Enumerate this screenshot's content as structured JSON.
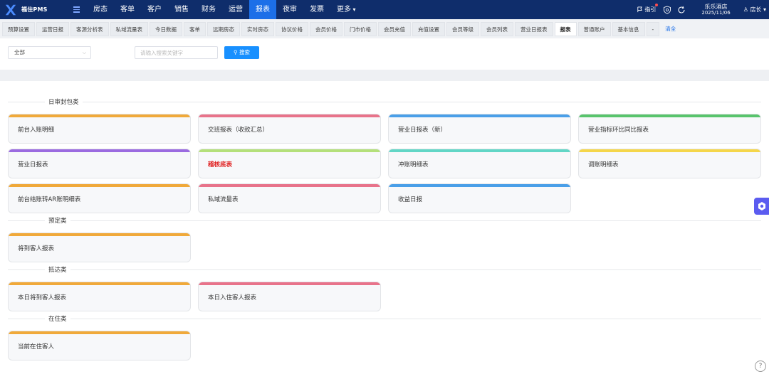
{
  "brand": {
    "name": "福住PMS"
  },
  "nav": {
    "items": [
      {
        "label": "房态",
        "active": false
      },
      {
        "label": "客单",
        "active": false
      },
      {
        "label": "客户",
        "active": false
      },
      {
        "label": "销售",
        "active": false
      },
      {
        "label": "财务",
        "active": false
      },
      {
        "label": "运营",
        "active": false
      },
      {
        "label": "报表",
        "active": true
      },
      {
        "label": "夜审",
        "active": false
      },
      {
        "label": "发票",
        "active": false
      },
      {
        "label": "更多",
        "active": false
      }
    ],
    "guide_label": "指引",
    "hotel_name": "乐乐酒店",
    "date": "2025/11/06",
    "user_label": "店长"
  },
  "tabs": [
    {
      "label": "预算设置",
      "active": false
    },
    {
      "label": "运营日报",
      "active": false
    },
    {
      "label": "客源分析表",
      "active": false
    },
    {
      "label": "私域流量表",
      "active": false
    },
    {
      "label": "今日数据",
      "active": false
    },
    {
      "label": "客单",
      "active": false
    },
    {
      "label": "远期房态",
      "active": false
    },
    {
      "label": "实时房态",
      "active": false
    },
    {
      "label": "协议价格",
      "active": false
    },
    {
      "label": "会员价格",
      "active": false
    },
    {
      "label": "门市价格",
      "active": false
    },
    {
      "label": "会员充值",
      "active": false
    },
    {
      "label": "充值设置",
      "active": false
    },
    {
      "label": "会员等级",
      "active": false
    },
    {
      "label": "会员列表",
      "active": false
    },
    {
      "label": "营业日报表",
      "active": false
    },
    {
      "label": "报表",
      "active": true
    },
    {
      "label": "普通账户",
      "active": false
    },
    {
      "label": "基本信息",
      "active": false
    },
    {
      "label": "-",
      "active": false
    }
  ],
  "tabs_clear_label": "清全",
  "filter": {
    "select_value": "全部",
    "search_placeholder": "请输入搜索关键字",
    "search_button": "搜索"
  },
  "colors": {
    "orange": "#f0a93a",
    "red": "#e8738a",
    "blue": "#4a9fe8",
    "green": "#58c46c",
    "purple": "#9b6be0",
    "lime": "#b4e07a",
    "teal": "#62d6c6",
    "yellow": "#f5d64a"
  },
  "sections": [
    {
      "title": "日审封包类",
      "cards": [
        {
          "label": "前台入账明细",
          "color": "orange",
          "highlight": false
        },
        {
          "label": "交班报表（收款汇总）",
          "color": "red",
          "highlight": false
        },
        {
          "label": "营业日报表（新）",
          "color": "blue",
          "highlight": false
        },
        {
          "label": "营业指标环比同比报表",
          "color": "green",
          "highlight": false
        },
        {
          "label": "营业日报表",
          "color": "purple",
          "highlight": false
        },
        {
          "label": "稽核底表",
          "color": "lime",
          "highlight": true
        },
        {
          "label": "冲账明细表",
          "color": "teal",
          "highlight": false
        },
        {
          "label": "调账明细表",
          "color": "yellow",
          "highlight": false
        },
        {
          "label": "前台结账转AR账明细表",
          "color": "orange",
          "highlight": false
        },
        {
          "label": "私域流量表",
          "color": "red",
          "highlight": false
        },
        {
          "label": "收益日报",
          "color": "blue",
          "highlight": false
        }
      ]
    },
    {
      "title": "预定类",
      "cards": [
        {
          "label": "将到客人报表",
          "color": "orange",
          "highlight": false
        }
      ]
    },
    {
      "title": "抵达类",
      "cards": [
        {
          "label": "本日将到客人报表",
          "color": "orange",
          "highlight": false
        },
        {
          "label": "本日入住客人报表",
          "color": "red",
          "highlight": false
        }
      ]
    },
    {
      "title": "在住类",
      "cards": [
        {
          "label": "当前在住客人",
          "color": "orange",
          "highlight": false
        }
      ]
    }
  ],
  "help_label": "?"
}
